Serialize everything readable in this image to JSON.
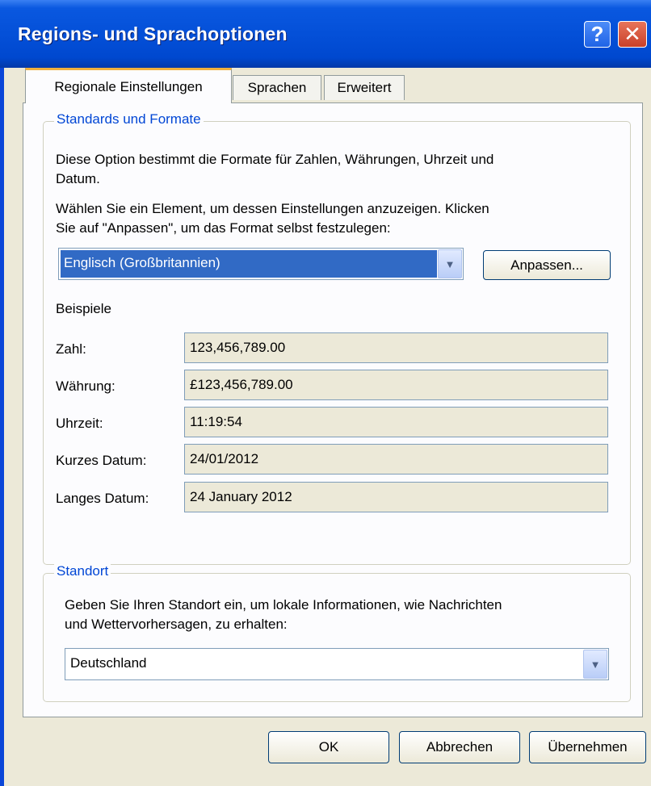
{
  "window": {
    "title": "Regions- und Sprachoptionen",
    "help_glyph": "?",
    "close_glyph": "✕"
  },
  "tabs": [
    {
      "label": "Regionale Einstellungen",
      "active": true
    },
    {
      "label": "Sprachen",
      "active": false
    },
    {
      "label": "Erweitert",
      "active": false
    }
  ],
  "formats": {
    "legend": "Standards und Formate",
    "desc_line1": "Diese Option bestimmt die Formate für Zahlen, Währungen, Uhrzeit und",
    "desc_line2": "Datum.",
    "instr_line1": "Wählen Sie ein Element, um dessen Einstellungen anzuzeigen. Klicken",
    "instr_line2": "Sie auf \"Anpassen\", um das Format selbst festzulegen:",
    "selected_format": "Englisch (Großbritannien)",
    "customize_label": "Anpassen...",
    "examples_heading": "Beispiele",
    "examples": [
      {
        "label": "Zahl:",
        "value": "123,456,789.00"
      },
      {
        "label": "Währung:",
        "value": "£123,456,789.00"
      },
      {
        "label": "Uhrzeit:",
        "value": "11:19:54"
      },
      {
        "label": "Kurzes Datum:",
        "value": "24/01/2012"
      },
      {
        "label": "Langes Datum:",
        "value": "24 January 2012"
      }
    ]
  },
  "location": {
    "legend": "Standort",
    "desc_line1": "Geben Sie Ihren Standort ein, um lokale Informationen, wie Nachrichten",
    "desc_line2": "und Wettervorhersagen, zu erhalten:",
    "selected_location": "Deutschland"
  },
  "buttons": {
    "ok": "OK",
    "cancel": "Abbrechen",
    "apply": "Übernehmen"
  },
  "colors": {
    "title_bar": "#0450d8",
    "group_legend": "#0046d5",
    "selection": "#316ac5",
    "active_tab_accent": "#f0b03c"
  }
}
